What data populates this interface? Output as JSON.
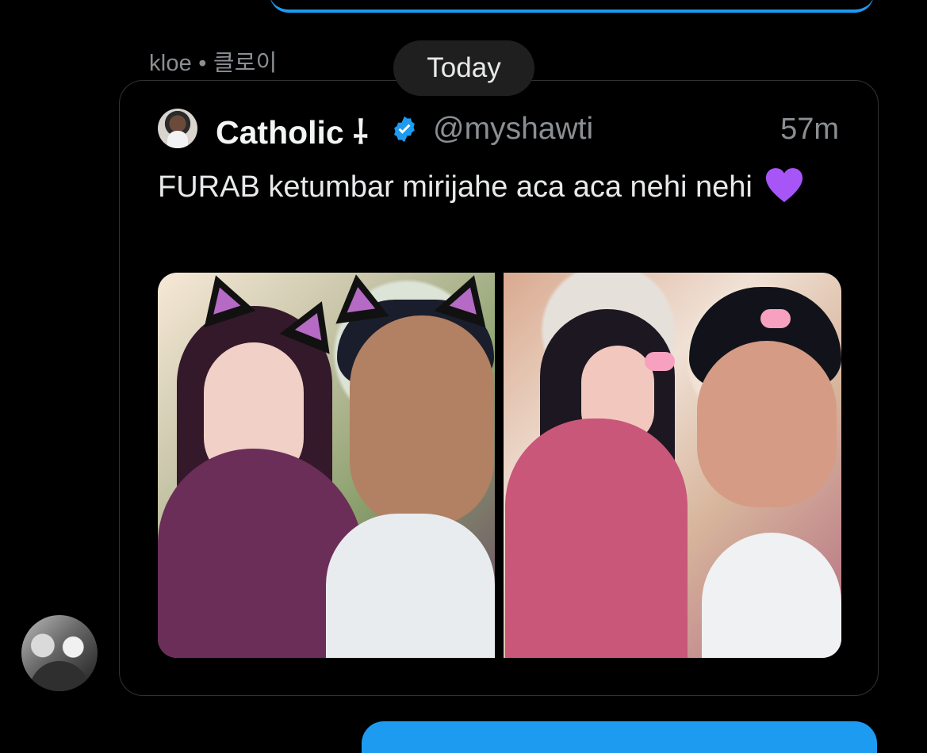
{
  "sender": {
    "label": "kloe • 클로이"
  },
  "date_separator": {
    "label": "Today"
  },
  "tweet": {
    "display_name": "Catholic ⸸",
    "handle": "@myshawti",
    "timestamp": "57m",
    "text": "FURAB ketumbar mirijahe aca aca nehi nehi",
    "verified_color": "#1d9bf0",
    "heart_color": "#a855f7"
  },
  "colors": {
    "background": "#000000",
    "card_border": "#2f3336",
    "muted_text": "#8b8f93",
    "primary_text": "#e7e9ea",
    "accent": "#1d9bf0"
  },
  "icons": {
    "verified": "verified-badge-icon",
    "heart": "purple-heart-icon"
  }
}
